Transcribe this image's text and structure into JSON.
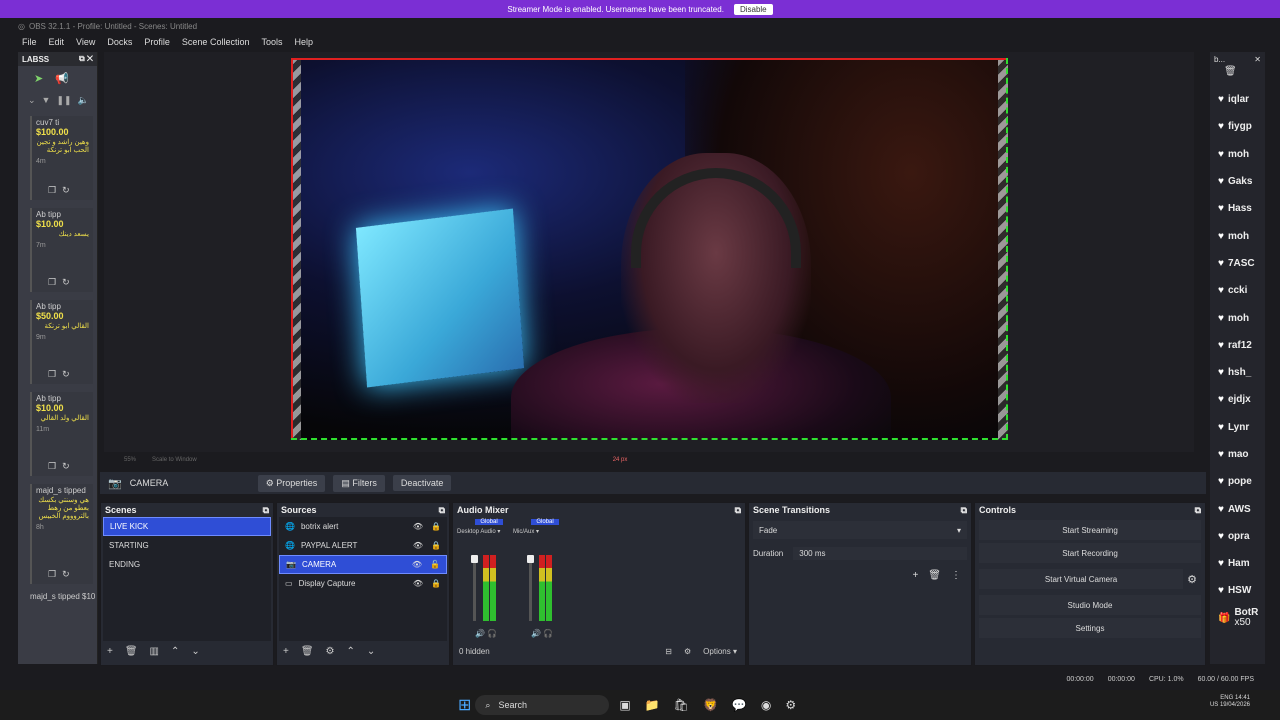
{
  "streamer_bar": {
    "message": "Streamer Mode is enabled. Usernames have been truncated.",
    "disable_label": "Disable"
  },
  "title": "OBS 32.1.1 - Profile: Untitled - Scenes: Untitled",
  "menu": [
    "File",
    "Edit",
    "View",
    "Docks",
    "Profile",
    "Scene Collection",
    "Tools",
    "Help"
  ],
  "left_dock": {
    "title": "LABSS",
    "tips": [
      {
        "who": "cuv7 ti",
        "amount": "$100.00",
        "message": "وهين راشد و تجين الحب ابو ترنكة",
        "age": "4m"
      },
      {
        "who": "Ab tipp",
        "amount": "$10.00",
        "message": "يسعد دينك",
        "age": "7m"
      },
      {
        "who": "Ab tipp",
        "amount": "$50.00",
        "message": "القالي ابو ترنكة",
        "age": "9m"
      },
      {
        "who": "Ab tipp",
        "amount": "$10.00",
        "message": "القالي ولد القالي",
        "age": "11m"
      },
      {
        "who": "majd_s tipped",
        "amount": "",
        "message": "هي وسنتي بكسك بعطو من رهط بالتروووم الخبيس",
        "age": "8h"
      }
    ],
    "bottom_tip": "majd_s tipped $10"
  },
  "preview_status": {
    "scale": "55%",
    "scale_mode": "Scale to Window",
    "size_label": "24 px"
  },
  "source_toolbar": {
    "selected": "CAMERA",
    "properties": "Properties",
    "filters": "Filters",
    "deactivate": "Deactivate"
  },
  "scenes": {
    "title": "Scenes",
    "items": [
      "LIVE KICK",
      "STARTING",
      "ENDING"
    ]
  },
  "sources": {
    "title": "Sources",
    "items": [
      "botrix alert",
      "PAYPAL ALERT",
      "CAMERA",
      "Display Capture"
    ]
  },
  "audio_mixer": {
    "title": "Audio Mixer",
    "channels": [
      {
        "badge": "Global",
        "device": "Desktop Audio"
      },
      {
        "badge": "Global",
        "device": "Mic/Aux"
      }
    ],
    "hidden": "0 hidden",
    "options": "Options"
  },
  "transitions": {
    "title": "Scene Transitions",
    "type": "Fade",
    "duration_label": "Duration",
    "duration_value": "300 ms"
  },
  "controls": {
    "title": "Controls",
    "buttons": [
      "Start Streaming",
      "Start Recording",
      "Start Virtual Camera",
      "Studio Mode",
      "Settings"
    ]
  },
  "right_dock": {
    "title": "b...",
    "users": [
      "iqlar",
      "fiygp",
      "moh",
      "Gaks",
      "Hass",
      "moh",
      "7ASC",
      "ccki",
      "moh",
      "raf12",
      "hsh_",
      "ejdjx",
      "Lynr",
      "mao",
      "pope",
      "AWS",
      "opra",
      "Ham",
      "HSW"
    ],
    "last_user": "BotR",
    "last_count": "x50"
  },
  "status": {
    "stream_time": "00:00:00",
    "rec_time": "00:00:00",
    "cpu": "CPU: 1.0%",
    "fps": "60.00 / 60.00 FPS"
  },
  "taskbar": {
    "search": "Search",
    "lang": "ENG",
    "region": "US",
    "time": "14:41",
    "date": "19/04/2026"
  }
}
